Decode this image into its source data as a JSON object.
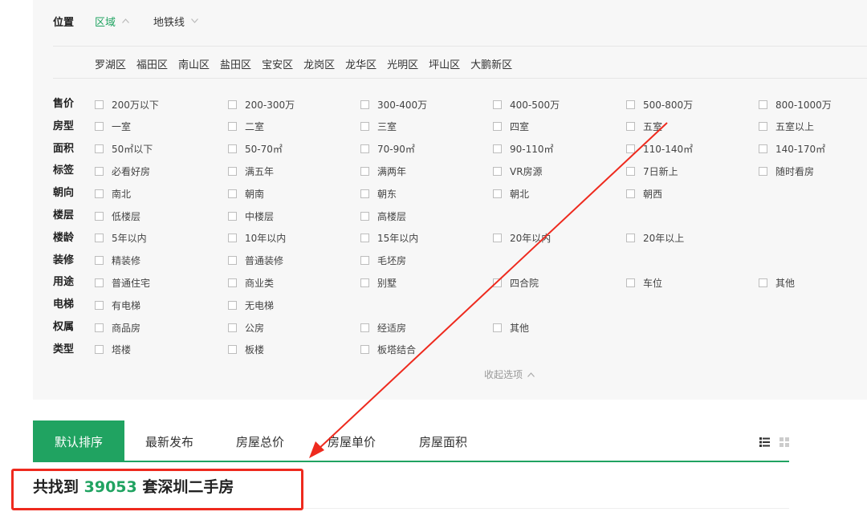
{
  "location": {
    "label": "位置",
    "tabs": [
      {
        "label": "区域",
        "active": true,
        "chevron": "chevron-up-icon"
      },
      {
        "label": "地铁线",
        "active": false,
        "chevron": "chevron-down-icon"
      }
    ],
    "districts": [
      "罗湖区",
      "福田区",
      "南山区",
      "盐田区",
      "宝安区",
      "龙岗区",
      "龙华区",
      "光明区",
      "坪山区",
      "大鹏新区"
    ]
  },
  "filters": [
    {
      "label": "售价",
      "options": [
        "200万以下",
        "200-300万",
        "300-400万",
        "400-500万",
        "500-800万",
        "800-1000万"
      ]
    },
    {
      "label": "房型",
      "options": [
        "一室",
        "二室",
        "三室",
        "四室",
        "五室",
        "五室以上"
      ]
    },
    {
      "label": "面积",
      "options": [
        "50㎡以下",
        "50-70㎡",
        "70-90㎡",
        "90-110㎡",
        "110-140㎡",
        "140-170㎡"
      ]
    },
    {
      "label": "标签",
      "options": [
        "必看好房",
        "满五年",
        "满两年",
        "VR房源",
        "7日新上",
        "随时看房"
      ]
    },
    {
      "label": "朝向",
      "options": [
        "南北",
        "朝南",
        "朝东",
        "朝北",
        "朝西"
      ]
    },
    {
      "label": "楼层",
      "options": [
        "低楼层",
        "中楼层",
        "高楼层"
      ]
    },
    {
      "label": "楼龄",
      "options": [
        "5年以内",
        "10年以内",
        "15年以内",
        "20年以内",
        "20年以上"
      ]
    },
    {
      "label": "装修",
      "options": [
        "精装修",
        "普通装修",
        "毛坯房"
      ]
    },
    {
      "label": "用途",
      "options": [
        "普通住宅",
        "商业类",
        "别墅",
        "四合院",
        "车位",
        "其他"
      ]
    },
    {
      "label": "电梯",
      "options": [
        "有电梯",
        "无电梯"
      ]
    },
    {
      "label": "权属",
      "options": [
        "商品房",
        "公房",
        "经适房",
        "其他"
      ]
    },
    {
      "label": "类型",
      "options": [
        "塔楼",
        "板楼",
        "板塔结合"
      ]
    }
  ],
  "collapse_label": "收起选项",
  "sort_tabs": [
    {
      "label": "默认排序",
      "active": true
    },
    {
      "label": "最新发布",
      "active": false
    },
    {
      "label": "房屋总价",
      "active": false
    },
    {
      "label": "房屋单价",
      "active": false
    },
    {
      "label": "房屋面积",
      "active": false
    }
  ],
  "view_icons": [
    "list-view-icon",
    "grid-view-icon"
  ],
  "result": {
    "prefix": "共找到",
    "count": "39053",
    "suffix": "套深圳二手房"
  },
  "colors": {
    "accent": "#20a361",
    "annotation": "#ee2a1e"
  }
}
